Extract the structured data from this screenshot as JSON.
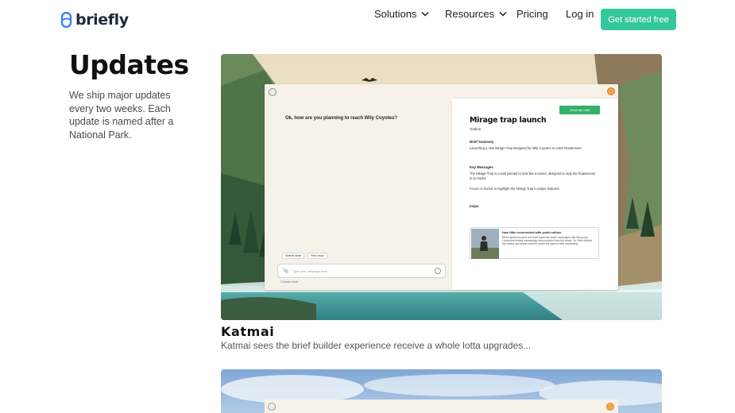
{
  "header": {
    "logo_text": "briefly",
    "nav": [
      {
        "label": "Solutions",
        "has_dropdown": true
      },
      {
        "label": "Resources",
        "has_dropdown": true
      },
      {
        "label": "Pricing",
        "has_dropdown": false
      }
    ],
    "login_label": "Log in",
    "cta_label": "Get started free"
  },
  "intro": {
    "title": "Updates",
    "text": "We ship major updates every two weeks. Each update is named after a National Park."
  },
  "updates": [
    {
      "title": "Katmai",
      "description": "Katmai sees the brief builder experience receive a whole lotta upgrades...",
      "screenshot": {
        "chat_question": "Ok, how are you planning to reach Wily Coyotes?",
        "chip_1": "Search drive",
        "chip_2": "Find inspo",
        "message_placeholder": "Type your message here...",
        "choose_mode": "Choose mode",
        "generate_button": "Generate brief",
        "doc_title": "Mirage trap launch",
        "doc_outline": "Outline",
        "brief_summary_heading": "Brief Summary",
        "brief_summary_text": "Launching a new Mirage Trap designed for Wily Coyotes to catch Roadrunner.",
        "key_messages_heading": "Key Messages",
        "key_messages_text_1": "The Mirage Trap is a wall painted to look like a tunnel, designed to stop the Roadrunner in its tracks.",
        "key_messages_text_2": "Focus on humor to highlight the Mirage Trap's unique features.",
        "inspo_heading": "Inspo",
        "inspo_card_title": "How Nike reconnected with youth culture",
        "inspo_card_text": "Nike's global success and their superstar-laden campaigns had left young Londoners feeling increasingly disconnected from the brand. So, Nike ditched the celebs and made London's youth the stars of their advertising."
      }
    }
  ],
  "colors": {
    "accent": "#35c79c",
    "logo_blue": "#3b82f6",
    "generate_button": "#35b06b"
  }
}
